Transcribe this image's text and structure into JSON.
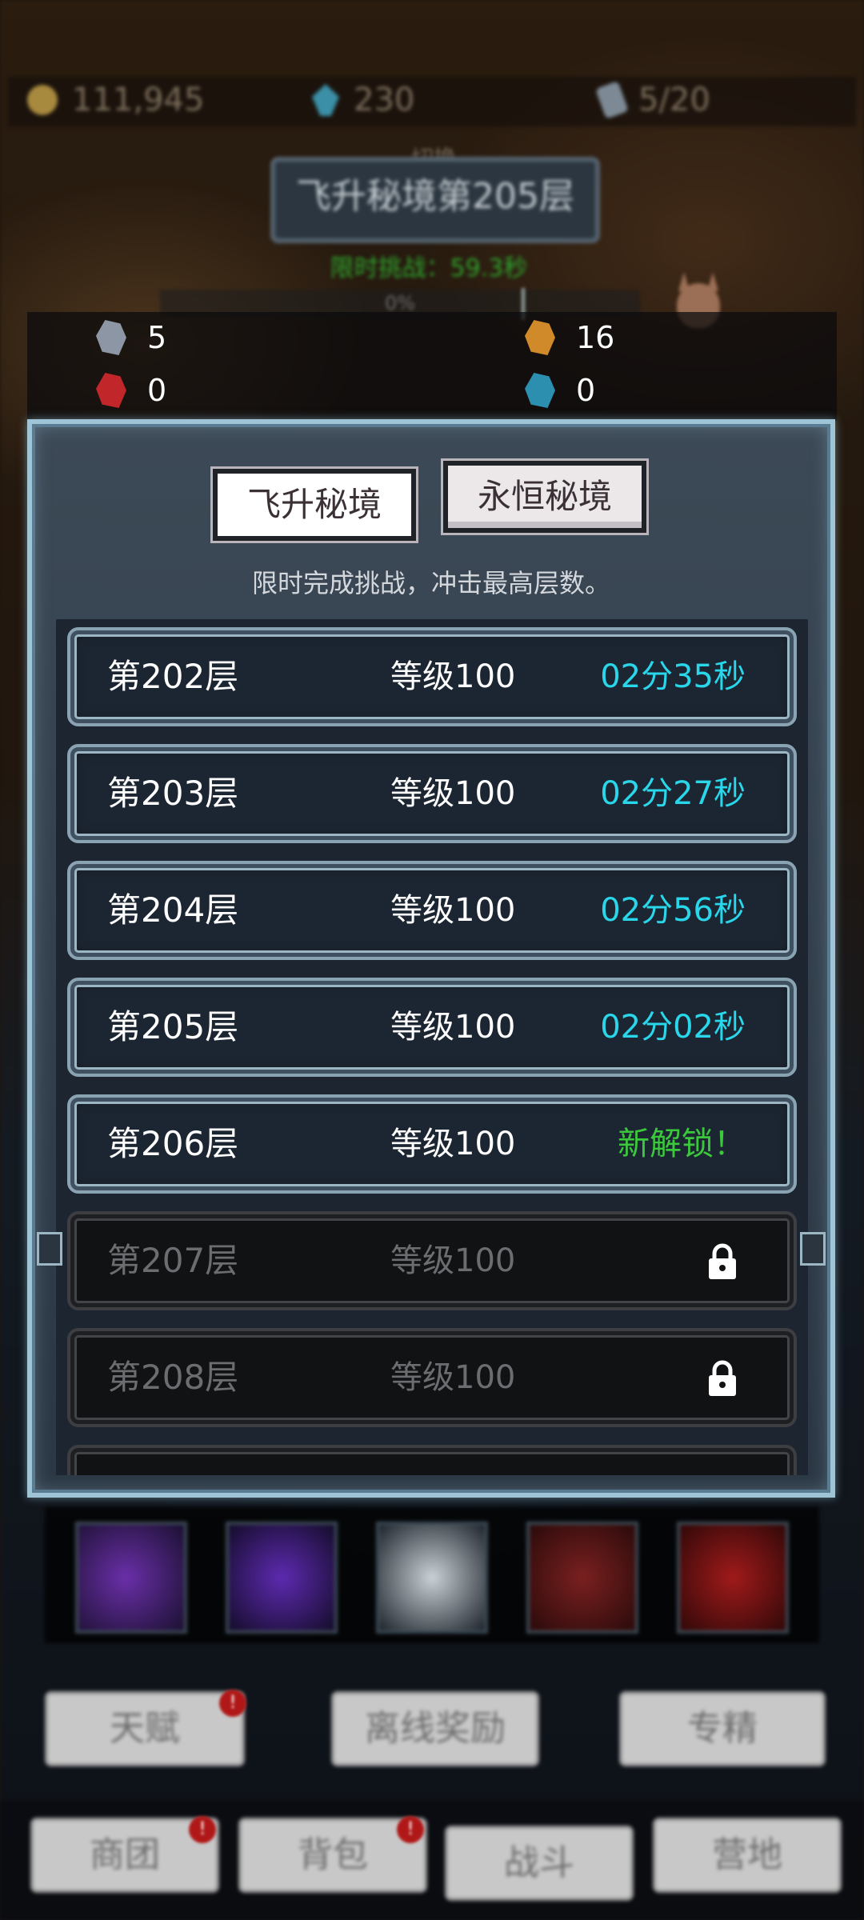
{
  "resources": {
    "gold": "111,945",
    "gems": "230",
    "scrolls": "5/20"
  },
  "header": {
    "switch_label": "切换",
    "title": "飞升秘境第205层",
    "timer": "限时挑战：59.3秒",
    "progress": "0%"
  },
  "materials": [
    {
      "icon": "gray-ore-icon",
      "count": "5",
      "color": "#8c96a4"
    },
    {
      "icon": "orange-ore-icon",
      "count": "16",
      "color": "#d08a2a"
    },
    {
      "icon": "red-ore-icon",
      "count": "0",
      "color": "#c0262a"
    },
    {
      "icon": "blue-ore-icon",
      "count": "0",
      "color": "#2c8fb0"
    }
  ],
  "panel": {
    "tabs": [
      {
        "label": "飞升秘境",
        "active": false
      },
      {
        "label": "永恒秘境",
        "active": true
      }
    ],
    "subtitle": "限时完成挑战，冲击最高层数。"
  },
  "floors": [
    {
      "floor": "第202层",
      "level": "等级100",
      "time": "02分35秒",
      "locked": false
    },
    {
      "floor": "第203层",
      "level": "等级100",
      "time": "02分27秒",
      "locked": false
    },
    {
      "floor": "第204层",
      "level": "等级100",
      "time": "02分56秒",
      "locked": false
    },
    {
      "floor": "第205层",
      "level": "等级100",
      "time": "02分02秒",
      "locked": false,
      "current": true
    },
    {
      "floor": "第206层",
      "level": "等级100",
      "status": "新解锁！",
      "locked": false
    },
    {
      "floor": "第207层",
      "level": "等级100",
      "locked": true
    },
    {
      "floor": "第208层",
      "level": "等级100",
      "locked": true
    }
  ],
  "buttons": {
    "talent": "天赋",
    "offline_reward": "离线奖励",
    "mastery": "专精",
    "guild": "商团",
    "backpack": "背包",
    "battle": "战斗",
    "camp": "营地",
    "badge": "!"
  },
  "colors": {
    "time_color": "#29d6ea",
    "new_unlock_color": "#3cc83c",
    "panel_border": "#9fc4d6"
  }
}
